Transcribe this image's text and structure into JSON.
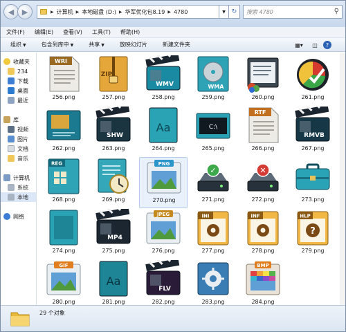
{
  "address": {
    "crumbs": [
      "计算机",
      "本地磁盘 (D:)",
      "华军优化包8.19",
      "4780"
    ],
    "search_placeholder": "搜索 4780"
  },
  "menu": [
    "文件(F)",
    "编辑(E)",
    "查看(V)",
    "工具(T)",
    "帮助(H)"
  ],
  "toolbar": {
    "organize": "组织",
    "include_in_library": "包含到库中",
    "share": "共享",
    "slideshow": "放映幻灯片",
    "new_folder": "新建文件夹"
  },
  "nav": {
    "favorites": "收藏夹",
    "fav_item1": "234",
    "fav_item2": "下载",
    "fav_item3": "桌面",
    "fav_item4": "最近",
    "libraries": "库",
    "lib_item1": "视频",
    "lib_item2": "图片",
    "lib_item3": "文档",
    "lib_item4": "音乐",
    "computer": "计算机",
    "comp_item1": "系统",
    "comp_item2": "本地",
    "network": "网络"
  },
  "files": [
    {
      "name": "256.png",
      "icon": "wri-document-icon",
      "label": "WRI"
    },
    {
      "name": "257.png",
      "icon": "zip-archive-icon",
      "label": "ZIP"
    },
    {
      "name": "258.png",
      "icon": "wmv-clapper-icon",
      "label": "WMV"
    },
    {
      "name": "259.png",
      "icon": "wma-audio-icon",
      "label": "WMA"
    },
    {
      "name": "260.png",
      "icon": "registry-editor-icon",
      "label": ""
    },
    {
      "name": "261.png",
      "icon": "pie-chart-check-icon",
      "label": ""
    },
    {
      "name": "262.png",
      "icon": "spreadsheet-image-icon",
      "label": ""
    },
    {
      "name": "263.png",
      "icon": "shw-clapper-icon",
      "label": "SHW"
    },
    {
      "name": "264.png",
      "icon": "font-aa-icon",
      "label": "Aa"
    },
    {
      "name": "265.png",
      "icon": "command-prompt-icon",
      "label": "C:\\"
    },
    {
      "name": "266.png",
      "icon": "rtf-document-icon",
      "label": "RTF"
    },
    {
      "name": "267.png",
      "icon": "rmvb-clapper-icon",
      "label": "RMVB"
    },
    {
      "name": "268.png",
      "icon": "reg-document-icon",
      "label": "REG"
    },
    {
      "name": "269.png",
      "icon": "document-clock-icon",
      "label": ""
    },
    {
      "name": "270.png",
      "icon": "png-image-icon",
      "label": "PNG"
    },
    {
      "name": "271.png",
      "icon": "drive-check-icon",
      "label": ""
    },
    {
      "name": "272.png",
      "icon": "drive-error-icon",
      "label": ""
    },
    {
      "name": "273.png",
      "icon": "briefcase-icon",
      "label": ""
    },
    {
      "name": "274.png",
      "icon": "blank-document-icon",
      "label": ""
    },
    {
      "name": "275.png",
      "icon": "mp4-clapper-icon",
      "label": "MP4"
    },
    {
      "name": "276.png",
      "icon": "jpeg-image-icon",
      "label": "JPEG"
    },
    {
      "name": "277.png",
      "icon": "ini-settings-icon",
      "label": "INI"
    },
    {
      "name": "278.png",
      "icon": "inf-settings-icon",
      "label": "INF"
    },
    {
      "name": "279.png",
      "icon": "hlp-help-icon",
      "label": "HLP"
    },
    {
      "name": "280.png",
      "icon": "gif-image-icon",
      "label": "GIF"
    },
    {
      "name": "281.png",
      "icon": "font-aa-dark-icon",
      "label": "Aa"
    },
    {
      "name": "282.png",
      "icon": "flv-clapper-icon",
      "label": "FLV"
    },
    {
      "name": "283.png",
      "icon": "control-panel-icon",
      "label": ""
    },
    {
      "name": "284.png",
      "icon": "bmp-image-icon",
      "label": "BMP"
    }
  ],
  "selected_file": "270.png",
  "status": {
    "count": "29 个对象"
  }
}
